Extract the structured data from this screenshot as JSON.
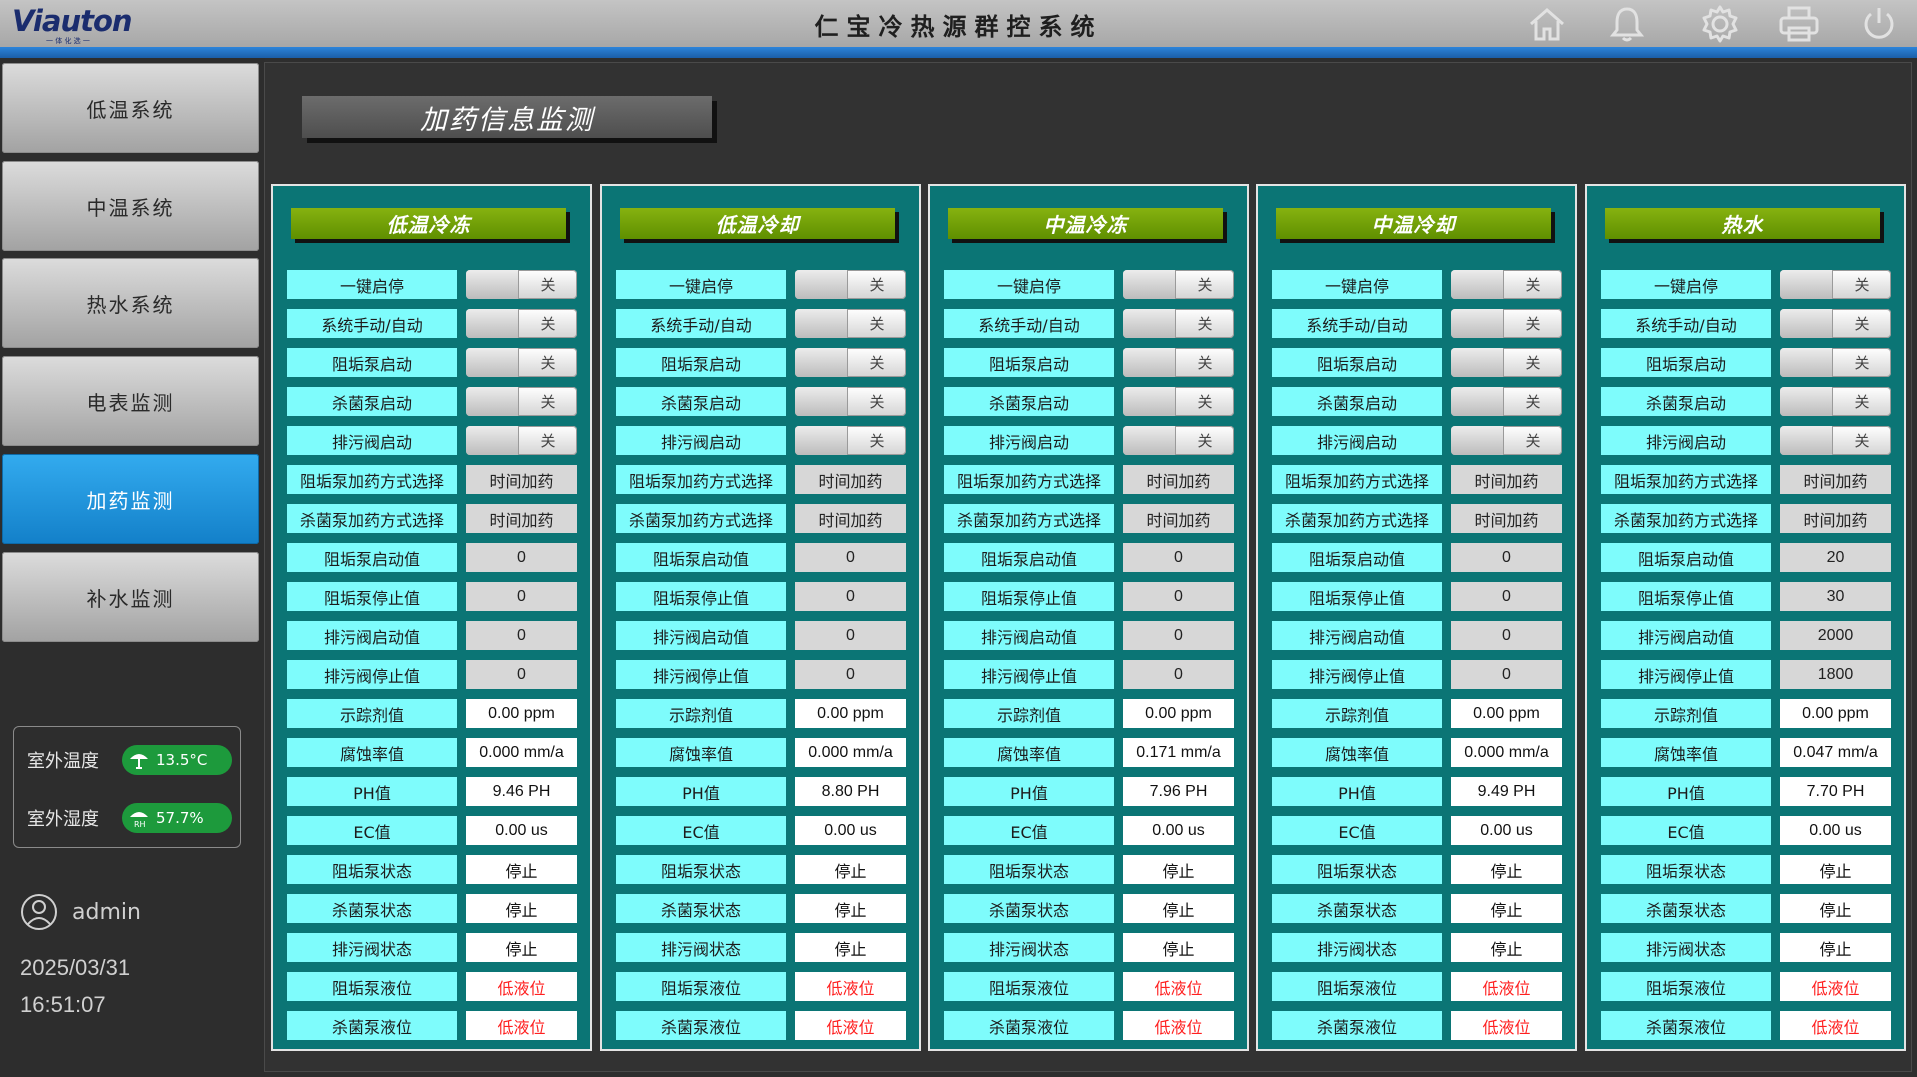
{
  "header": {
    "logo_text": "Viauton",
    "logo_sub": "一 体 化 选 一",
    "title": "仁宝冷热源群控系统",
    "icons": [
      "home-icon",
      "bell-icon",
      "gear-icon",
      "printer-icon",
      "power-icon"
    ]
  },
  "sidebar": {
    "items": [
      {
        "label": "低温系统",
        "active": false
      },
      {
        "label": "中温系统",
        "active": false
      },
      {
        "label": "热水系统",
        "active": false
      },
      {
        "label": "电表监测",
        "active": false
      },
      {
        "label": "加药监测",
        "active": true
      },
      {
        "label": "补水监测",
        "active": false
      }
    ],
    "weather": {
      "temp_label": "室外温度",
      "temp_value": "13.5°C",
      "humidity_label": "室外湿度",
      "humidity_value": "57.7%"
    },
    "user": "admin",
    "date": "2025/03/31",
    "time": "16:51:07"
  },
  "page_title": "加药信息监测",
  "row_labels": [
    "一键启停",
    "系统手动/自动",
    "阻垢泵启动",
    "杀菌泵启动",
    "排污阀启动",
    "阻垢泵加药方式选择",
    "杀菌泵加药方式选择",
    "阻垢泵启动值",
    "阻垢泵停止值",
    "排污阀启动值",
    "排污阀停止值",
    "示踪剂值",
    "腐蚀率值",
    "PH值",
    "EC值",
    "阻垢泵状态",
    "杀菌泵状态",
    "排污阀状态",
    "阻垢泵液位",
    "杀菌泵液位"
  ],
  "row_kinds": [
    "toggle",
    "toggle",
    "toggle",
    "toggle",
    "toggle",
    "gray",
    "gray",
    "gray",
    "gray",
    "gray",
    "gray",
    "white",
    "white",
    "white",
    "white",
    "white",
    "white",
    "white",
    "warn",
    "warn"
  ],
  "panels": [
    {
      "title": "低温冷冻",
      "values": [
        "关",
        "关",
        "关",
        "关",
        "关",
        "时间加药",
        "时间加药",
        "0",
        "0",
        "0",
        "0",
        "0.00 ppm",
        "0.000 mm/a",
        "9.46 PH",
        "0.00 us",
        "停止",
        "停止",
        "停止",
        "低液位",
        "低液位"
      ]
    },
    {
      "title": "低温冷却",
      "values": [
        "关",
        "关",
        "关",
        "关",
        "关",
        "时间加药",
        "时间加药",
        "0",
        "0",
        "0",
        "0",
        "0.00 ppm",
        "0.000 mm/a",
        "8.80 PH",
        "0.00 us",
        "停止",
        "停止",
        "停止",
        "低液位",
        "低液位"
      ]
    },
    {
      "title": "中温冷冻",
      "values": [
        "关",
        "关",
        "关",
        "关",
        "关",
        "时间加药",
        "时间加药",
        "0",
        "0",
        "0",
        "0",
        "0.00 ppm",
        "0.171 mm/a",
        "7.96 PH",
        "0.00 us",
        "停止",
        "停止",
        "停止",
        "低液位",
        "低液位"
      ]
    },
    {
      "title": "中温冷却",
      "values": [
        "关",
        "关",
        "关",
        "关",
        "关",
        "时间加药",
        "时间加药",
        "0",
        "0",
        "0",
        "0",
        "0.00 ppm",
        "0.000 mm/a",
        "9.49 PH",
        "0.00 us",
        "停止",
        "停止",
        "停止",
        "低液位",
        "低液位"
      ]
    },
    {
      "title": "热水",
      "values": [
        "关",
        "关",
        "关",
        "关",
        "关",
        "时间加药",
        "时间加药",
        "20",
        "30",
        "2000",
        "1800",
        "0.00 ppm",
        "0.047 mm/a",
        "7.70 PH",
        "0.00 us",
        "停止",
        "停止",
        "停止",
        "低液位",
        "低液位"
      ]
    }
  ],
  "colors": {
    "panel_bg": "#0b7575",
    "label_bg": "#7efcfc",
    "title_green": "#6f9f05",
    "active_nav": "#1a8fd9",
    "warning_text": "#ff2020"
  }
}
